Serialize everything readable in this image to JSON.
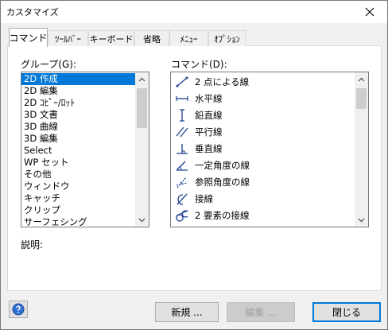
{
  "window": {
    "title": "カスタマイズ"
  },
  "tabs": [
    {
      "label": "コマンド",
      "active": true
    },
    {
      "label": "ﾂｰﾙﾊﾞｰ"
    },
    {
      "label": "キーボード"
    },
    {
      "label": "省略"
    },
    {
      "label": "ﾒﾆｭｰ"
    },
    {
      "label": "ｵﾌﾟｼｮﾝ"
    }
  ],
  "groups": {
    "label": "グループ(G):",
    "selected": "2D 作成",
    "items": [
      "2D 作成",
      "2D 編集",
      "2D ｺﾋﾟｰ/ﾛｯﾄ",
      "3D 文書",
      "3D 曲線",
      "3D 編集",
      "Select",
      "WP セット",
      "その他",
      "ウィンドウ",
      "キャッチ",
      "クリップ",
      "サーフェシング"
    ]
  },
  "commands": {
    "label": "コマンド(D):",
    "items": [
      {
        "label": "2 点による線",
        "icon": "two-point-line-icon"
      },
      {
        "label": "水平線",
        "icon": "horizontal-line-icon"
      },
      {
        "label": "鉛直線",
        "icon": "vertical-line-icon"
      },
      {
        "label": "平行線",
        "icon": "parallel-line-icon"
      },
      {
        "label": "垂直線",
        "icon": "perpendicular-line-icon"
      },
      {
        "label": "一定角度の線",
        "icon": "constant-angle-line-icon"
      },
      {
        "label": "参照角度の線",
        "icon": "reference-angle-line-icon"
      },
      {
        "label": "接線",
        "icon": "tangent-line-icon"
      },
      {
        "label": "2 要素の接線",
        "icon": "two-element-tangent-icon"
      }
    ]
  },
  "description": {
    "label": "説明:"
  },
  "buttons": {
    "new": "新規 ...",
    "edit": "編集 ...",
    "close": "閉じる"
  },
  "colors": {
    "selection": "#0078d7",
    "icon": "#1b3f8f"
  }
}
